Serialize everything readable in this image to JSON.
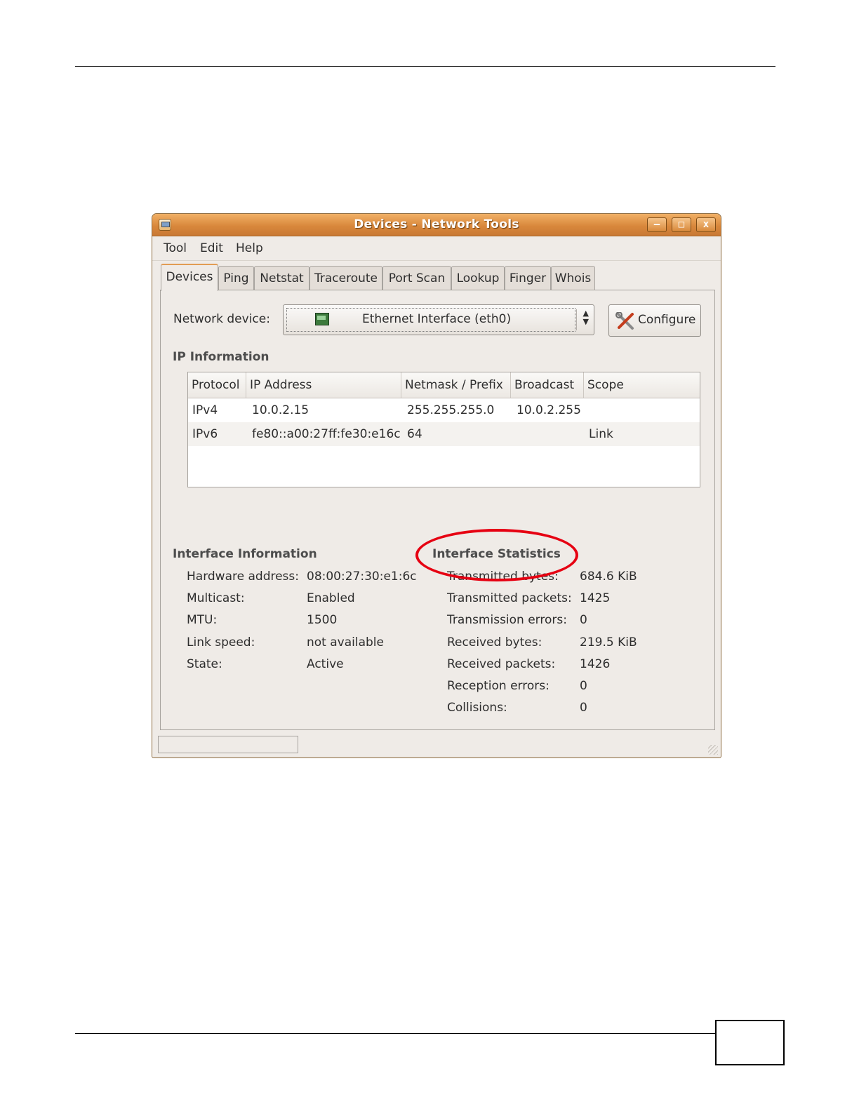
{
  "window": {
    "title": "Devices - Network Tools",
    "controls": {
      "minimize": "–",
      "maximize": "□",
      "close": "x"
    }
  },
  "menu": {
    "items": [
      "Tool",
      "Edit",
      "Help"
    ]
  },
  "tabs": [
    "Devices",
    "Ping",
    "Netstat",
    "Traceroute",
    "Port Scan",
    "Lookup",
    "Finger",
    "Whois"
  ],
  "active_tab": "Devices",
  "device": {
    "label": "Network device:",
    "selected": "Ethernet Interface (eth0)",
    "configure_label": "Configure"
  },
  "ip_info": {
    "heading": "IP Information",
    "columns": [
      "Protocol",
      "IP Address",
      "Netmask / Prefix",
      "Broadcast",
      "Scope"
    ],
    "rows": [
      [
        "IPv4",
        "10.0.2.15",
        "255.255.255.0",
        "10.0.2.255",
        ""
      ],
      [
        "IPv6",
        "fe80::a00:27ff:fe30:e16c",
        "64",
        "",
        "Link"
      ]
    ]
  },
  "interface_info": {
    "heading": "Interface Information",
    "rows": [
      {
        "label": "Hardware address:",
        "value": "08:00:27:30:e1:6c"
      },
      {
        "label": "Multicast:",
        "value": "Enabled"
      },
      {
        "label": "MTU:",
        "value": "1500"
      },
      {
        "label": "Link speed:",
        "value": "not available"
      },
      {
        "label": "State:",
        "value": "Active"
      }
    ]
  },
  "interface_stats": {
    "heading": "Interface Statistics",
    "rows": [
      {
        "label": "Transmitted bytes:",
        "value": "684.6 KiB"
      },
      {
        "label": "Transmitted packets:",
        "value": "1425"
      },
      {
        "label": "Transmission errors:",
        "value": "0"
      },
      {
        "label": "Received bytes:",
        "value": "219.5 KiB"
      },
      {
        "label": "Received packets:",
        "value": "1426"
      },
      {
        "label": "Reception errors:",
        "value": "0"
      },
      {
        "label": "Collisions:",
        "value": "0"
      }
    ]
  },
  "colors": {
    "titlebar": "#d9883c",
    "highlight": "#e60012",
    "window_bg": "#efebe7"
  }
}
